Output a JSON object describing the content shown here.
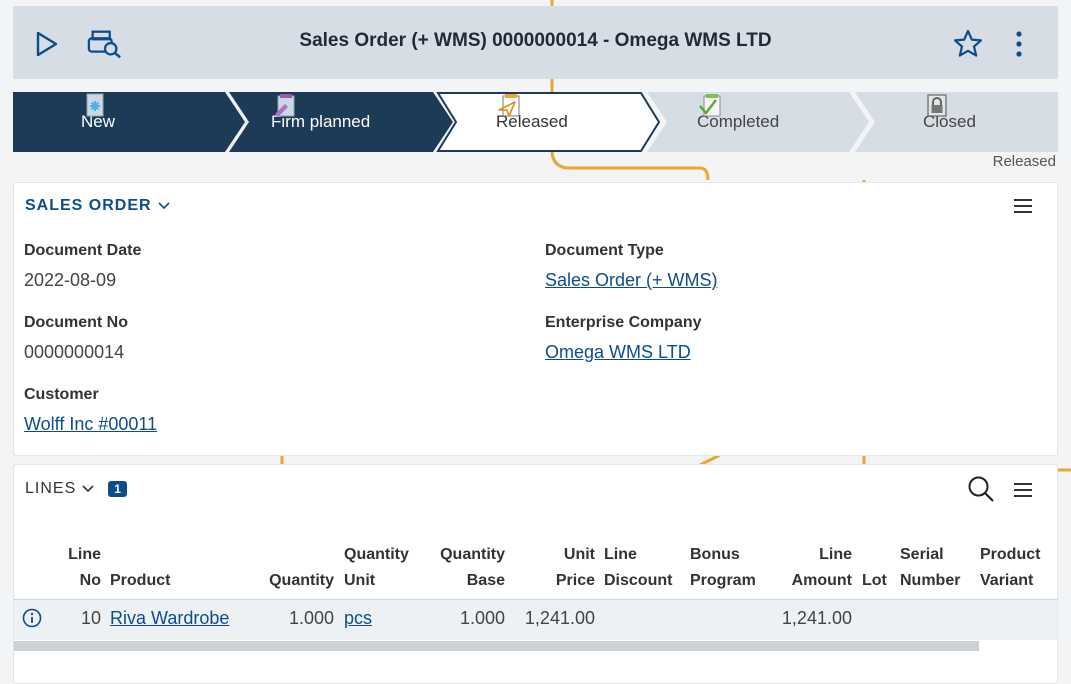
{
  "header": {
    "title": "Sales Order (+ WMS) 0000000014 - Omega WMS LTD",
    "icons": {
      "run": "play-icon",
      "lookup": "document-search-icon",
      "favorite": "star-icon",
      "more": "more-vertical-icon"
    }
  },
  "steps": [
    {
      "label": "New",
      "state": "done"
    },
    {
      "label": "Firm planned",
      "state": "done"
    },
    {
      "label": "Released",
      "state": "current"
    },
    {
      "label": "Completed",
      "state": "pending"
    },
    {
      "label": "Closed",
      "state": "pending"
    }
  ],
  "status_text": "Released",
  "sales_order": {
    "title": "SALES ORDER",
    "fields": {
      "document_date": {
        "label": "Document Date",
        "value": "2022-08-09"
      },
      "document_no": {
        "label": "Document No",
        "value": "0000000014"
      },
      "customer": {
        "label": "Customer",
        "value": "Wolff Inc #00011"
      },
      "document_type": {
        "label": "Document Type",
        "value": "Sales Order (+ WMS)"
      },
      "enterprise_company": {
        "label": "Enterprise Company",
        "value": "Omega WMS LTD"
      }
    }
  },
  "lines": {
    "title": "LINES",
    "count": "1",
    "columns": {
      "line_no": [
        "Line",
        "No"
      ],
      "product": [
        "",
        "Product"
      ],
      "quantity": [
        "",
        "Quantity"
      ],
      "quantity_unit": [
        "Quantity",
        "Unit"
      ],
      "quantity_base": [
        "Quantity",
        "Base"
      ],
      "unit_price": [
        "Unit",
        "Price"
      ],
      "line_discount": [
        "Line",
        "Discount"
      ],
      "bonus_program": [
        "Bonus",
        "Program"
      ],
      "line_amount": [
        "Line",
        "Amount"
      ],
      "lot": [
        "",
        "Lot"
      ],
      "serial_number": [
        "Serial",
        "Number"
      ],
      "product_variant": [
        "Product",
        "Variant"
      ]
    },
    "rows": [
      {
        "line_no": "10",
        "product": "Riva Wardrobe",
        "quantity": "1.000",
        "quantity_unit": "pcs",
        "quantity_base": "1.000",
        "unit_price": "1,241.00",
        "line_amount": "1,241.00"
      }
    ]
  },
  "colors": {
    "accent": "#0c4d8a",
    "step_done": "#1d3b56",
    "step_pending": "#d6dde5",
    "deco_line": "#f0a533"
  }
}
